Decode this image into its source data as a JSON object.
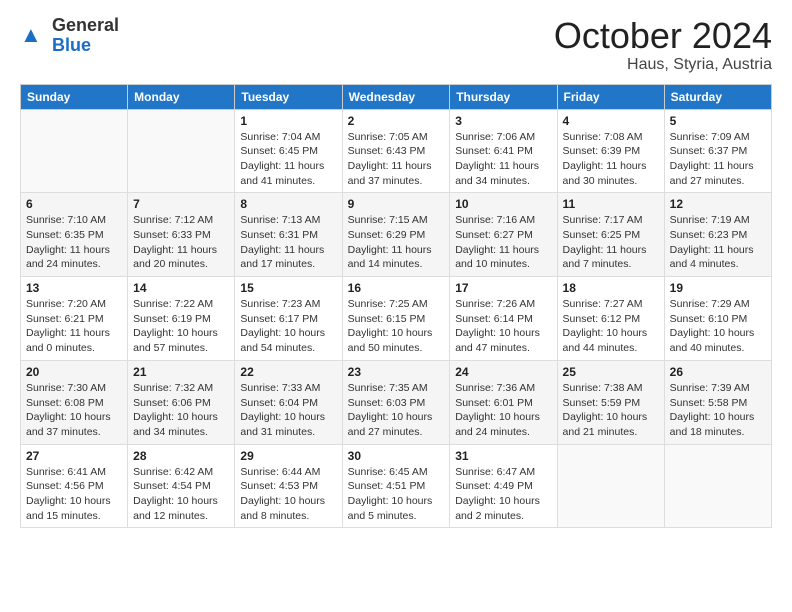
{
  "logo": {
    "general": "General",
    "blue": "Blue"
  },
  "title": "October 2024",
  "location": "Haus, Styria, Austria",
  "days_of_week": [
    "Sunday",
    "Monday",
    "Tuesday",
    "Wednesday",
    "Thursday",
    "Friday",
    "Saturday"
  ],
  "weeks": [
    [
      {
        "day": "",
        "info": ""
      },
      {
        "day": "",
        "info": ""
      },
      {
        "day": "1",
        "info": "Sunrise: 7:04 AM\nSunset: 6:45 PM\nDaylight: 11 hours and 41 minutes."
      },
      {
        "day": "2",
        "info": "Sunrise: 7:05 AM\nSunset: 6:43 PM\nDaylight: 11 hours and 37 minutes."
      },
      {
        "day": "3",
        "info": "Sunrise: 7:06 AM\nSunset: 6:41 PM\nDaylight: 11 hours and 34 minutes."
      },
      {
        "day": "4",
        "info": "Sunrise: 7:08 AM\nSunset: 6:39 PM\nDaylight: 11 hours and 30 minutes."
      },
      {
        "day": "5",
        "info": "Sunrise: 7:09 AM\nSunset: 6:37 PM\nDaylight: 11 hours and 27 minutes."
      }
    ],
    [
      {
        "day": "6",
        "info": "Sunrise: 7:10 AM\nSunset: 6:35 PM\nDaylight: 11 hours and 24 minutes."
      },
      {
        "day": "7",
        "info": "Sunrise: 7:12 AM\nSunset: 6:33 PM\nDaylight: 11 hours and 20 minutes."
      },
      {
        "day": "8",
        "info": "Sunrise: 7:13 AM\nSunset: 6:31 PM\nDaylight: 11 hours and 17 minutes."
      },
      {
        "day": "9",
        "info": "Sunrise: 7:15 AM\nSunset: 6:29 PM\nDaylight: 11 hours and 14 minutes."
      },
      {
        "day": "10",
        "info": "Sunrise: 7:16 AM\nSunset: 6:27 PM\nDaylight: 11 hours and 10 minutes."
      },
      {
        "day": "11",
        "info": "Sunrise: 7:17 AM\nSunset: 6:25 PM\nDaylight: 11 hours and 7 minutes."
      },
      {
        "day": "12",
        "info": "Sunrise: 7:19 AM\nSunset: 6:23 PM\nDaylight: 11 hours and 4 minutes."
      }
    ],
    [
      {
        "day": "13",
        "info": "Sunrise: 7:20 AM\nSunset: 6:21 PM\nDaylight: 11 hours and 0 minutes."
      },
      {
        "day": "14",
        "info": "Sunrise: 7:22 AM\nSunset: 6:19 PM\nDaylight: 10 hours and 57 minutes."
      },
      {
        "day": "15",
        "info": "Sunrise: 7:23 AM\nSunset: 6:17 PM\nDaylight: 10 hours and 54 minutes."
      },
      {
        "day": "16",
        "info": "Sunrise: 7:25 AM\nSunset: 6:15 PM\nDaylight: 10 hours and 50 minutes."
      },
      {
        "day": "17",
        "info": "Sunrise: 7:26 AM\nSunset: 6:14 PM\nDaylight: 10 hours and 47 minutes."
      },
      {
        "day": "18",
        "info": "Sunrise: 7:27 AM\nSunset: 6:12 PM\nDaylight: 10 hours and 44 minutes."
      },
      {
        "day": "19",
        "info": "Sunrise: 7:29 AM\nSunset: 6:10 PM\nDaylight: 10 hours and 40 minutes."
      }
    ],
    [
      {
        "day": "20",
        "info": "Sunrise: 7:30 AM\nSunset: 6:08 PM\nDaylight: 10 hours and 37 minutes."
      },
      {
        "day": "21",
        "info": "Sunrise: 7:32 AM\nSunset: 6:06 PM\nDaylight: 10 hours and 34 minutes."
      },
      {
        "day": "22",
        "info": "Sunrise: 7:33 AM\nSunset: 6:04 PM\nDaylight: 10 hours and 31 minutes."
      },
      {
        "day": "23",
        "info": "Sunrise: 7:35 AM\nSunset: 6:03 PM\nDaylight: 10 hours and 27 minutes."
      },
      {
        "day": "24",
        "info": "Sunrise: 7:36 AM\nSunset: 6:01 PM\nDaylight: 10 hours and 24 minutes."
      },
      {
        "day": "25",
        "info": "Sunrise: 7:38 AM\nSunset: 5:59 PM\nDaylight: 10 hours and 21 minutes."
      },
      {
        "day": "26",
        "info": "Sunrise: 7:39 AM\nSunset: 5:58 PM\nDaylight: 10 hours and 18 minutes."
      }
    ],
    [
      {
        "day": "27",
        "info": "Sunrise: 6:41 AM\nSunset: 4:56 PM\nDaylight: 10 hours and 15 minutes."
      },
      {
        "day": "28",
        "info": "Sunrise: 6:42 AM\nSunset: 4:54 PM\nDaylight: 10 hours and 12 minutes."
      },
      {
        "day": "29",
        "info": "Sunrise: 6:44 AM\nSunset: 4:53 PM\nDaylight: 10 hours and 8 minutes."
      },
      {
        "day": "30",
        "info": "Sunrise: 6:45 AM\nSunset: 4:51 PM\nDaylight: 10 hours and 5 minutes."
      },
      {
        "day": "31",
        "info": "Sunrise: 6:47 AM\nSunset: 4:49 PM\nDaylight: 10 hours and 2 minutes."
      },
      {
        "day": "",
        "info": ""
      },
      {
        "day": "",
        "info": ""
      }
    ]
  ]
}
